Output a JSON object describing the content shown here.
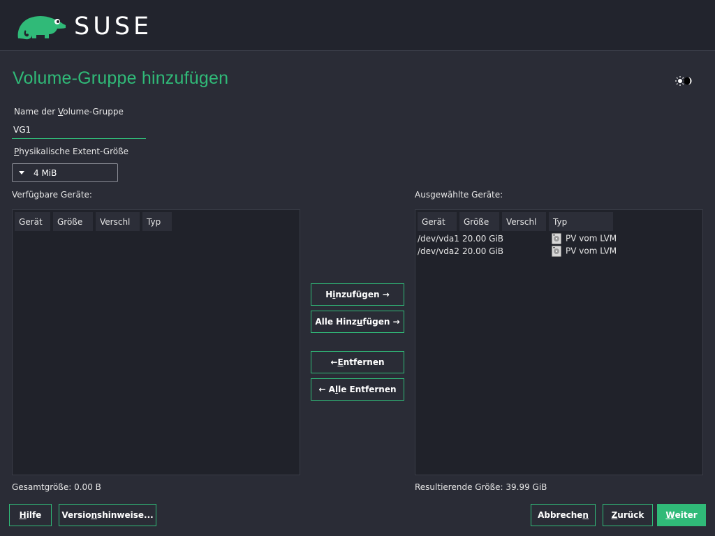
{
  "header": {
    "brand": "SUSE",
    "logo_icon": "chameleon-logo-icon",
    "brand_color": "#30ba78"
  },
  "page": {
    "title": "Volume-Gruppe hinzufügen",
    "theme_icon": "sun-moon-toggle-icon"
  },
  "form": {
    "vg_name_label_pre": "Name der ",
    "vg_name_label_key": "V",
    "vg_name_label_post": "olume-Gruppe",
    "vg_name_value": "VG1",
    "extent_label_key": "P",
    "extent_label_post": "hysikalische Extent-Größe",
    "extent_value": "4 MiB"
  },
  "available": {
    "label": "Verfügbare Geräte:",
    "columns": [
      "Gerät",
      "Größe",
      "Verschl",
      "Typ"
    ],
    "rows": [],
    "total": "Gesamtgröße: 0.00 B"
  },
  "selected": {
    "label": "Ausgewählte Geräte:",
    "columns": [
      "Gerät",
      "Größe",
      "Verschl",
      "Typ"
    ],
    "rows": [
      {
        "device": "/dev/vda1",
        "size": "20.00 GiB",
        "encrypted": "",
        "type": "PV vom LVM",
        "icon": "hard-disk-icon"
      },
      {
        "device": "/dev/vda2",
        "size": "20.00 GiB",
        "encrypted": "",
        "type": "PV vom LVM",
        "icon": "hard-disk-icon"
      }
    ],
    "total": "Resultierende Größe: 39.99 GiB"
  },
  "actions": {
    "add_pre": "H",
    "add_key": "i",
    "add_post": "nzufügen →",
    "add_all_pre": "Alle Hinz",
    "add_all_key": "u",
    "add_all_post": "fügen →",
    "remove_pre": "← ",
    "remove_key": "E",
    "remove_post": "ntfernen",
    "remove_all_pre": "← A",
    "remove_all_key": "l",
    "remove_all_post": "le Entfernen"
  },
  "footer": {
    "help_key": "H",
    "help_post": "ilfe",
    "release_pre": "Versio",
    "release_key": "n",
    "release_post": "shinweise...",
    "cancel_pre": "Abbreche",
    "cancel_key": "n",
    "cancel_post": "",
    "back_key": "Z",
    "back_post": "urück",
    "next_key": "W",
    "next_post": "eiter"
  }
}
